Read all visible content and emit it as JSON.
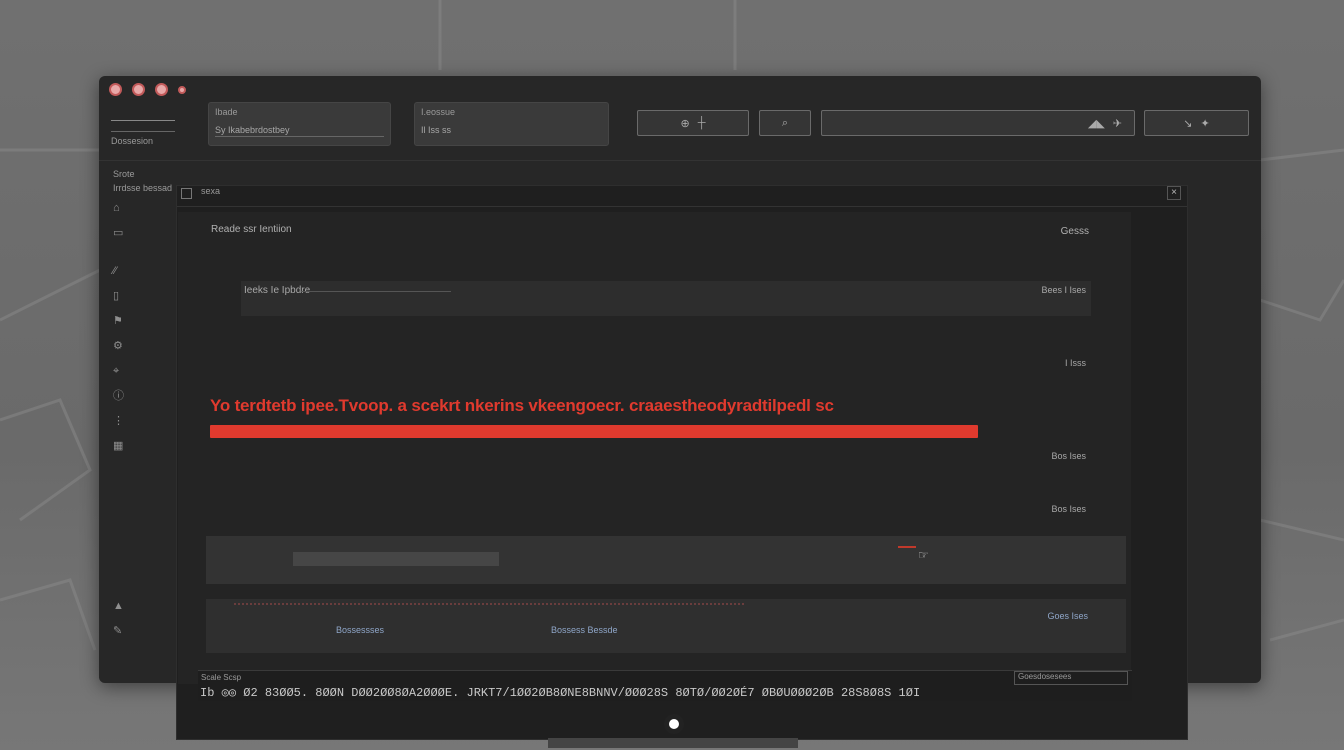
{
  "window": {
    "brand": {
      "text": "Dossesion"
    },
    "field_left": {
      "caption": "Ibade",
      "value": "Sy Ikabebrdostbey"
    },
    "field_mid": {
      "caption": "I.eossue",
      "value": "Il Iss ss"
    },
    "toolbar_buttons": [
      {
        "label": "Zoom"
      },
      {
        "label": "Search"
      },
      {
        "label": "Filter"
      },
      {
        "label": "Map"
      }
    ]
  },
  "sidebar": {
    "labels": [
      "Srote",
      "Irrdsse bessad"
    ],
    "items": [
      "home",
      "layers",
      "grid",
      "tag",
      "flag",
      "settings",
      "pin",
      "info",
      "more",
      "chart"
    ]
  },
  "panel": {
    "checkbox_text": "sexa",
    "close_label": "×"
  },
  "dialog": {
    "title": "Reade ssr Ientiion",
    "title_right": "Gesss",
    "row1_text": "Ieeks Ie Ipbdre",
    "meta": [
      "Bees I Ises",
      "I Isss",
      "Bos Ises",
      "Bos Ises"
    ],
    "error_message": "Yo terdtetb ipee.Tvoop. a  scekrt nkerins  vkeengoecr. craaestheodyradtilpedl sc",
    "results_links": [
      "Bossessses",
      "Bossess Bessde"
    ],
    "results_right": "Goes Ises"
  },
  "status": {
    "caption": "Scale Scsp",
    "right_caption": "Goesdosesees",
    "line": "Ib ◎◎ Ø2 83ØØ5. 8ØØN DØØ2ØØ8ØA2ØØØE. JRKT7/1ØØ2ØB8ØNE8BNNV/ØØØ28S 8ØTØ/ØØ2ØÉ7 ØBØUØØØ2ØB  28S8Ø8S 1ØI"
  },
  "colors": {
    "error_red": "#e03a2e",
    "window_bg": "#272727",
    "panel_bg": "#1f1f1f"
  }
}
